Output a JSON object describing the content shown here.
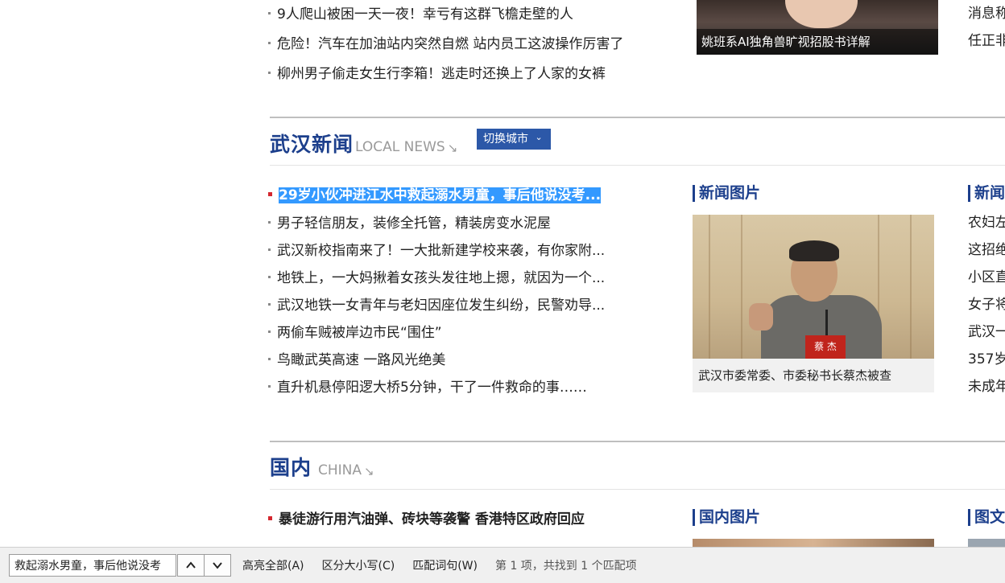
{
  "top_news": [
    "9人爬山被困一天一夜！幸亏有这群飞檐走壁的人",
    "危险！汽车在加油站内突然自燃 站内员工这波操作厉害了",
    "柳州男子偷走女生行李箱！逃走时还换上了人家的女裤"
  ],
  "top_photo_caption": "姚班系AI独角兽旷视招股书详解",
  "top_right": [
    "消息称",
    "任正非"
  ],
  "wuhan": {
    "title": "武汉新闻",
    "en": "LOCAL NEWS",
    "arrow": "↘",
    "city_button": "切换城市",
    "city_chevron": "⌄",
    "headline": "29岁小伙冲进江水中救起溺水男童，事后他说没考...",
    "items": [
      "男子轻信朋友，装修全托管，精装房变水泥屋",
      "武汉新校指南来了！一大批新建学校来袭，有你家附...",
      "地铁上，一大妈揪着女孩头发往地上摁，就因为一个...",
      "武汉地铁一女青年与老妇因座位发生纠纷，民警劝导...",
      "两偷车贼被岸边市民“围住”",
      "鸟瞰武英高速 一路风光绝美",
      "直升机悬停阳逻大桥5分钟，干了一件救命的事……"
    ],
    "photo_title": "新闻图片",
    "photo_sign": "蔡 杰",
    "photo_caption": "武汉市委常委、市委秘书长蔡杰被查",
    "right_title": "新闻",
    "right_items": [
      "农妇左",
      "这招绝",
      "小区直",
      "女子将",
      "武汉一",
      "357岁",
      "未成年"
    ]
  },
  "china": {
    "title": "国内",
    "en": "CHINA",
    "arrow": "↘",
    "headline": "暴徒游行用汽油弹、砖块等袭警 香港特区政府回应",
    "photo_title": "国内图片",
    "right_title": "图文"
  },
  "findbar": {
    "value": "救起溺水男童，事后他说没考",
    "highlight_all": "高亮全部(A)",
    "match_case": "区分大小写(C)",
    "whole_words": "匹配词句(W)",
    "status": "第 1 项，共找到 1 个匹配项"
  }
}
